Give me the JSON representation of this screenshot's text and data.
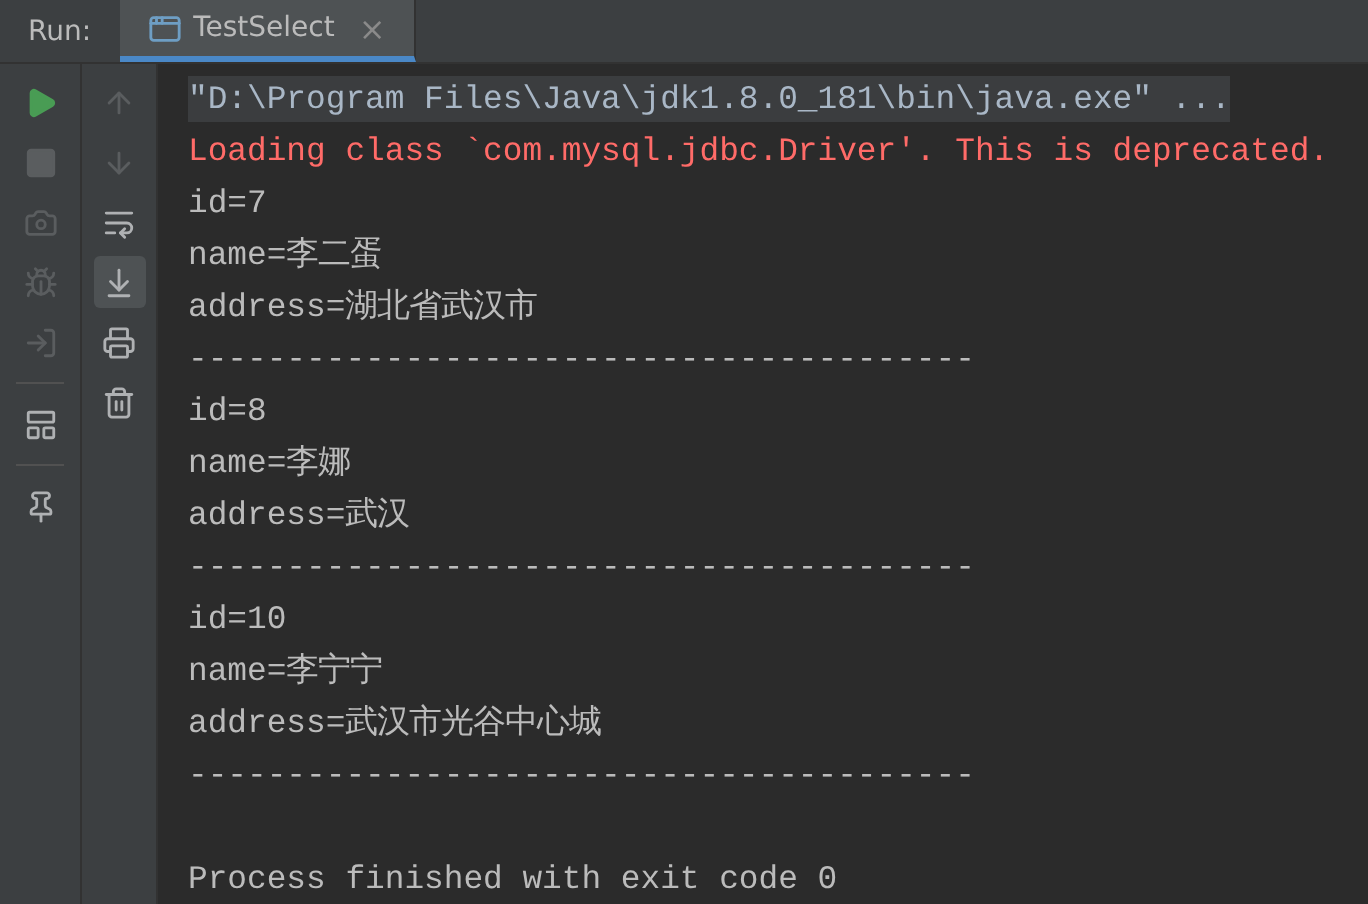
{
  "run_panel": {
    "label": "Run:",
    "tabs": [
      {
        "label": "TestSelect",
        "selected": true,
        "close": "×"
      }
    ]
  },
  "console": {
    "lines": [
      {
        "kind": "command",
        "text": "\"D:\\Program Files\\Java\\jdk1.8.0_181\\bin\\java.exe\" ..."
      },
      {
        "kind": "error",
        "text": "Loading class `com.mysql.jdbc.Driver'. This is deprecated."
      },
      {
        "kind": "output",
        "text": "id=7"
      },
      {
        "kind": "output",
        "text": "name=李二蛋"
      },
      {
        "kind": "output",
        "text": "address=湖北省武汉市"
      },
      {
        "kind": "output",
        "text": "----------------------------------------"
      },
      {
        "kind": "output",
        "text": "id=8"
      },
      {
        "kind": "output",
        "text": "name=李娜"
      },
      {
        "kind": "output",
        "text": "address=武汉"
      },
      {
        "kind": "output",
        "text": "----------------------------------------"
      },
      {
        "kind": "output",
        "text": "id=10"
      },
      {
        "kind": "output",
        "text": "name=李宁宁"
      },
      {
        "kind": "output",
        "text": "address=武汉市光谷中心城"
      },
      {
        "kind": "output",
        "text": "----------------------------------------"
      },
      {
        "kind": "blank"
      },
      {
        "kind": "output",
        "text": "Process finished with exit code 0"
      }
    ]
  }
}
